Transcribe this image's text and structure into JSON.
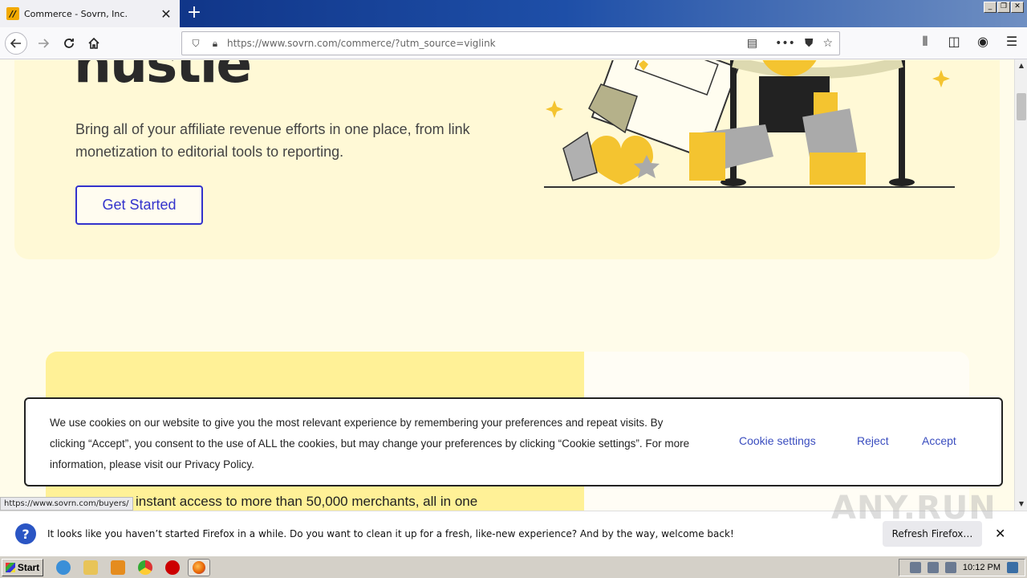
{
  "browser": {
    "tab_title": "Commerce - Sovrn, Inc.",
    "tab_favicon": "sovrn-logo-icon",
    "new_tab_label": "+",
    "url": "https://www.sovrn.com/commerce/?utm_source=viglink",
    "status_url": "https://www.sovrn.com/buyers/"
  },
  "hero": {
    "title": "hustle",
    "description": "Bring all of your affiliate revenue efforts in one place, from link monetization to editorial tools to reporting.",
    "cta_label": "Get Started"
  },
  "card": {
    "partial_text": "instant access to more than 50,000 merchants, all in one"
  },
  "cookie_banner": {
    "text": "We use cookies on our website to give you the most relevant experience by remembering your preferences and repeat visits. By clicking “Accept”, you consent to the use of ALL the cookies, but may change your preferences by clicking “Cookie settings”. For more information, please visit our Privacy Policy.",
    "settings_label": "Cookie settings",
    "reject_label": "Reject",
    "accept_label": "Accept"
  },
  "notification": {
    "text": "It looks like you haven’t started Firefox in a while. Do you want to clean it up for a fresh, like-new experience? And by the way, welcome back!",
    "button_label": "Refresh Firefox…",
    "close_label": "✕"
  },
  "watermark": "ANY.RUN",
  "taskbar": {
    "start_label": "Start",
    "clock": "10:12 PM"
  },
  "colors": {
    "accent_blue": "#3333cc",
    "hero_bg": "#fff9d6",
    "card_yellow": "#fff197"
  }
}
